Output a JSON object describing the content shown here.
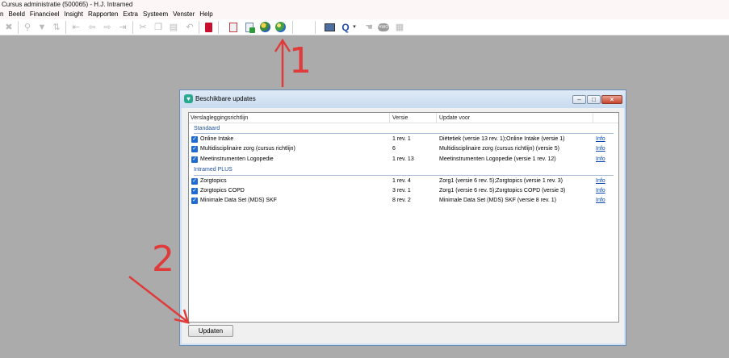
{
  "window": {
    "title": "Cursus administratie (500065) - H.J. Intramed"
  },
  "menu": {
    "items": [
      "n",
      "Beeld",
      "Financieel",
      "Insight",
      "Rapporten",
      "Extra",
      "Systeem",
      "Venster",
      "Help"
    ]
  },
  "toolbar": {
    "icons": [
      "trash-icon",
      "search-icon",
      "filter-icon",
      "sort-icon",
      "first-icon",
      "prev-icon",
      "next-icon",
      "last-icon",
      "cut-icon",
      "copy-icon",
      "paste-icon",
      "undo-icon",
      "book-icon",
      "check-doc-icon",
      "add-doc-icon",
      "globe-update-icon",
      "globe-icon",
      "monitor-icon",
      "q-icon",
      "hands-icon",
      "hwo-icon",
      "grid-icon"
    ]
  },
  "dialog": {
    "title": "Beschikbare updates",
    "columns": {
      "name": "Verslagleggingsrichtlijn",
      "versie": "Versie",
      "voor": "Update voor",
      "info": ""
    },
    "groups": [
      {
        "label": "Standaard",
        "rows": [
          {
            "name": "Online Intake",
            "versie": "1 rev. 1",
            "voor": "Diëtetiek (versie 13 rev. 1);Online Intake (versie 1)",
            "info": "Info",
            "checked": true
          },
          {
            "name": "Multidisciplinaire zorg (cursus richtlijn)",
            "versie": "6",
            "voor": "Multidisciplinaire zorg (cursus richtlijn) (versie 5)",
            "info": "Info",
            "checked": true
          },
          {
            "name": "Meetinstrumenten Logopedie",
            "versie": "1 rev. 13",
            "voor": "Meetinstrumenten Logopedie (versie 1 rev. 12)",
            "info": "Info",
            "checked": true
          }
        ]
      },
      {
        "label": "Intramed PLUS",
        "rows": [
          {
            "name": "Zorgtopics",
            "versie": "1 rev. 4",
            "voor": "Zorg1 (versie 6 rev. 5);Zorgtopics (versie 1 rev. 3)",
            "info": "Info",
            "checked": true
          },
          {
            "name": "Zorgtopics COPD",
            "versie": "3 rev. 1",
            "voor": "Zorg1 (versie 6 rev. 5);Zorgtopics COPD (versie 3)",
            "info": "Info",
            "checked": true
          },
          {
            "name": "Minimale Data Set (MDS) SKF",
            "versie": "8 rev. 2",
            "voor": "Minimale Data Set (MDS) SKF (versie 8 rev. 1)",
            "info": "Info",
            "checked": true
          }
        ]
      }
    ],
    "update_button": "Updaten"
  },
  "annotations": {
    "marker_1": "1",
    "marker_2": "2",
    "color": "#e03b3b"
  }
}
